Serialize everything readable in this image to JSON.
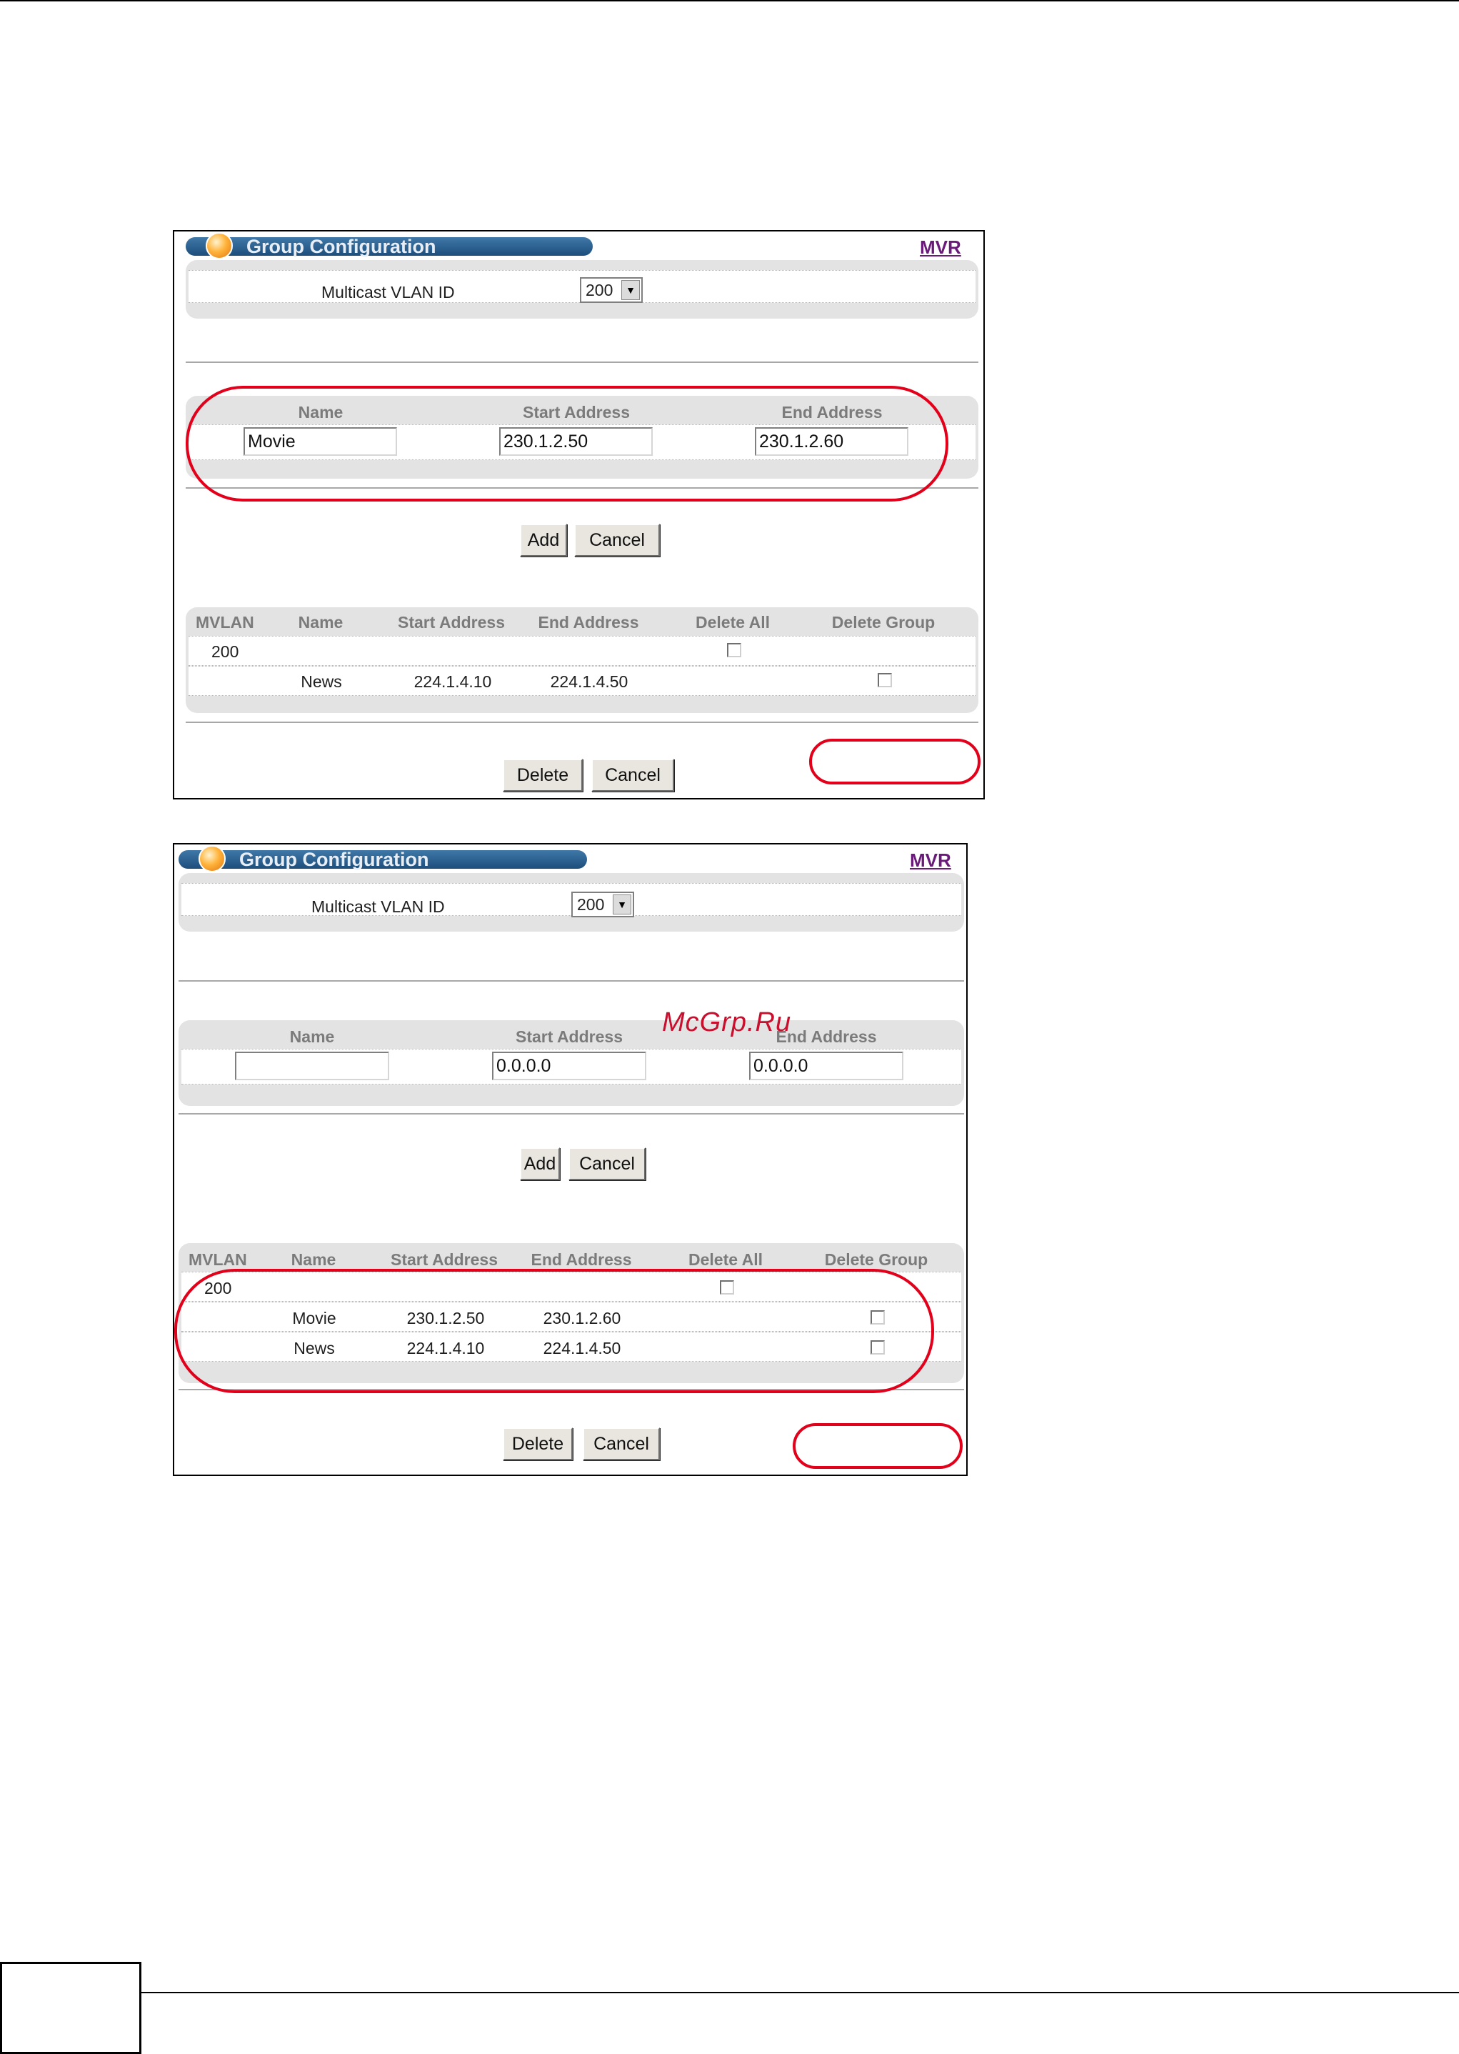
{
  "figures": [
    {
      "title": "Group Configuration",
      "link": "MVR",
      "vlan": {
        "label": "Multicast VLAN ID",
        "value": "200"
      },
      "form": {
        "headers": {
          "name": "Name",
          "start": "Start Address",
          "end": "End Address"
        },
        "values": {
          "name": "Movie",
          "start": "230.1.2.50",
          "end": "230.1.2.60"
        }
      },
      "add_label": "Add",
      "cancel_label": "Cancel",
      "table": {
        "headers": [
          "MVLAN",
          "Name",
          "Start Address",
          "End Address",
          "Delete All",
          "Delete Group"
        ],
        "group_row": {
          "mvlan": "200"
        },
        "rows": [
          {
            "name": "News",
            "start": "224.1.4.10",
            "end": "224.1.4.50"
          }
        ]
      },
      "delete_label": "Delete",
      "cancel2_label": "Cancel"
    },
    {
      "title": "Group Configuration",
      "link": "MVR",
      "vlan": {
        "label": "Multicast VLAN ID",
        "value": "200"
      },
      "form": {
        "headers": {
          "name": "Name",
          "start": "Start Address",
          "end": "End Address"
        },
        "values": {
          "name": "",
          "start": "0.0.0.0",
          "end": "0.0.0.0"
        }
      },
      "add_label": "Add",
      "cancel_label": "Cancel",
      "table": {
        "headers": [
          "MVLAN",
          "Name",
          "Start Address",
          "End Address",
          "Delete All",
          "Delete Group"
        ],
        "group_row": {
          "mvlan": "200"
        },
        "rows": [
          {
            "name": "Movie",
            "start": "230.1.2.50",
            "end": "230.1.2.60"
          },
          {
            "name": "News",
            "start": "224.1.4.10",
            "end": "224.1.4.50"
          }
        ]
      },
      "delete_label": "Delete",
      "cancel2_label": "Cancel"
    }
  ],
  "watermark": "McGrp.Ru",
  "annotation_color": "#e2001a",
  "title_bar_color": "#2a5c8c",
  "link_color": "#6a1b7a"
}
